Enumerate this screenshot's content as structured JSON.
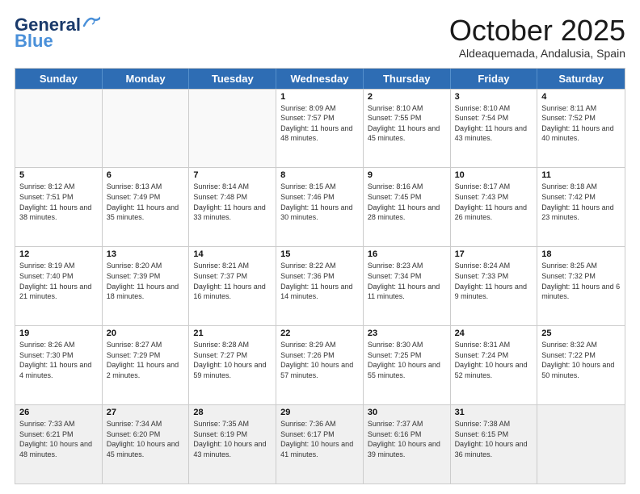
{
  "logo": {
    "line1": "General",
    "line2": "Blue"
  },
  "title": "October 2025",
  "subtitle": "Aldeaquemada, Andalusia, Spain",
  "days": [
    "Sunday",
    "Monday",
    "Tuesday",
    "Wednesday",
    "Thursday",
    "Friday",
    "Saturday"
  ],
  "weeks": [
    [
      {
        "day": "",
        "text": ""
      },
      {
        "day": "",
        "text": ""
      },
      {
        "day": "",
        "text": ""
      },
      {
        "day": "1",
        "text": "Sunrise: 8:09 AM\nSunset: 7:57 PM\nDaylight: 11 hours and 48 minutes."
      },
      {
        "day": "2",
        "text": "Sunrise: 8:10 AM\nSunset: 7:55 PM\nDaylight: 11 hours and 45 minutes."
      },
      {
        "day": "3",
        "text": "Sunrise: 8:10 AM\nSunset: 7:54 PM\nDaylight: 11 hours and 43 minutes."
      },
      {
        "day": "4",
        "text": "Sunrise: 8:11 AM\nSunset: 7:52 PM\nDaylight: 11 hours and 40 minutes."
      }
    ],
    [
      {
        "day": "5",
        "text": "Sunrise: 8:12 AM\nSunset: 7:51 PM\nDaylight: 11 hours and 38 minutes."
      },
      {
        "day": "6",
        "text": "Sunrise: 8:13 AM\nSunset: 7:49 PM\nDaylight: 11 hours and 35 minutes."
      },
      {
        "day": "7",
        "text": "Sunrise: 8:14 AM\nSunset: 7:48 PM\nDaylight: 11 hours and 33 minutes."
      },
      {
        "day": "8",
        "text": "Sunrise: 8:15 AM\nSunset: 7:46 PM\nDaylight: 11 hours and 30 minutes."
      },
      {
        "day": "9",
        "text": "Sunrise: 8:16 AM\nSunset: 7:45 PM\nDaylight: 11 hours and 28 minutes."
      },
      {
        "day": "10",
        "text": "Sunrise: 8:17 AM\nSunset: 7:43 PM\nDaylight: 11 hours and 26 minutes."
      },
      {
        "day": "11",
        "text": "Sunrise: 8:18 AM\nSunset: 7:42 PM\nDaylight: 11 hours and 23 minutes."
      }
    ],
    [
      {
        "day": "12",
        "text": "Sunrise: 8:19 AM\nSunset: 7:40 PM\nDaylight: 11 hours and 21 minutes."
      },
      {
        "day": "13",
        "text": "Sunrise: 8:20 AM\nSunset: 7:39 PM\nDaylight: 11 hours and 18 minutes."
      },
      {
        "day": "14",
        "text": "Sunrise: 8:21 AM\nSunset: 7:37 PM\nDaylight: 11 hours and 16 minutes."
      },
      {
        "day": "15",
        "text": "Sunrise: 8:22 AM\nSunset: 7:36 PM\nDaylight: 11 hours and 14 minutes."
      },
      {
        "day": "16",
        "text": "Sunrise: 8:23 AM\nSunset: 7:34 PM\nDaylight: 11 hours and 11 minutes."
      },
      {
        "day": "17",
        "text": "Sunrise: 8:24 AM\nSunset: 7:33 PM\nDaylight: 11 hours and 9 minutes."
      },
      {
        "day": "18",
        "text": "Sunrise: 8:25 AM\nSunset: 7:32 PM\nDaylight: 11 hours and 6 minutes."
      }
    ],
    [
      {
        "day": "19",
        "text": "Sunrise: 8:26 AM\nSunset: 7:30 PM\nDaylight: 11 hours and 4 minutes."
      },
      {
        "day": "20",
        "text": "Sunrise: 8:27 AM\nSunset: 7:29 PM\nDaylight: 11 hours and 2 minutes."
      },
      {
        "day": "21",
        "text": "Sunrise: 8:28 AM\nSunset: 7:27 PM\nDaylight: 10 hours and 59 minutes."
      },
      {
        "day": "22",
        "text": "Sunrise: 8:29 AM\nSunset: 7:26 PM\nDaylight: 10 hours and 57 minutes."
      },
      {
        "day": "23",
        "text": "Sunrise: 8:30 AM\nSunset: 7:25 PM\nDaylight: 10 hours and 55 minutes."
      },
      {
        "day": "24",
        "text": "Sunrise: 8:31 AM\nSunset: 7:24 PM\nDaylight: 10 hours and 52 minutes."
      },
      {
        "day": "25",
        "text": "Sunrise: 8:32 AM\nSunset: 7:22 PM\nDaylight: 10 hours and 50 minutes."
      }
    ],
    [
      {
        "day": "26",
        "text": "Sunrise: 7:33 AM\nSunset: 6:21 PM\nDaylight: 10 hours and 48 minutes."
      },
      {
        "day": "27",
        "text": "Sunrise: 7:34 AM\nSunset: 6:20 PM\nDaylight: 10 hours and 45 minutes."
      },
      {
        "day": "28",
        "text": "Sunrise: 7:35 AM\nSunset: 6:19 PM\nDaylight: 10 hours and 43 minutes."
      },
      {
        "day": "29",
        "text": "Sunrise: 7:36 AM\nSunset: 6:17 PM\nDaylight: 10 hours and 41 minutes."
      },
      {
        "day": "30",
        "text": "Sunrise: 7:37 AM\nSunset: 6:16 PM\nDaylight: 10 hours and 39 minutes."
      },
      {
        "day": "31",
        "text": "Sunrise: 7:38 AM\nSunset: 6:15 PM\nDaylight: 10 hours and 36 minutes."
      },
      {
        "day": "",
        "text": ""
      }
    ]
  ]
}
